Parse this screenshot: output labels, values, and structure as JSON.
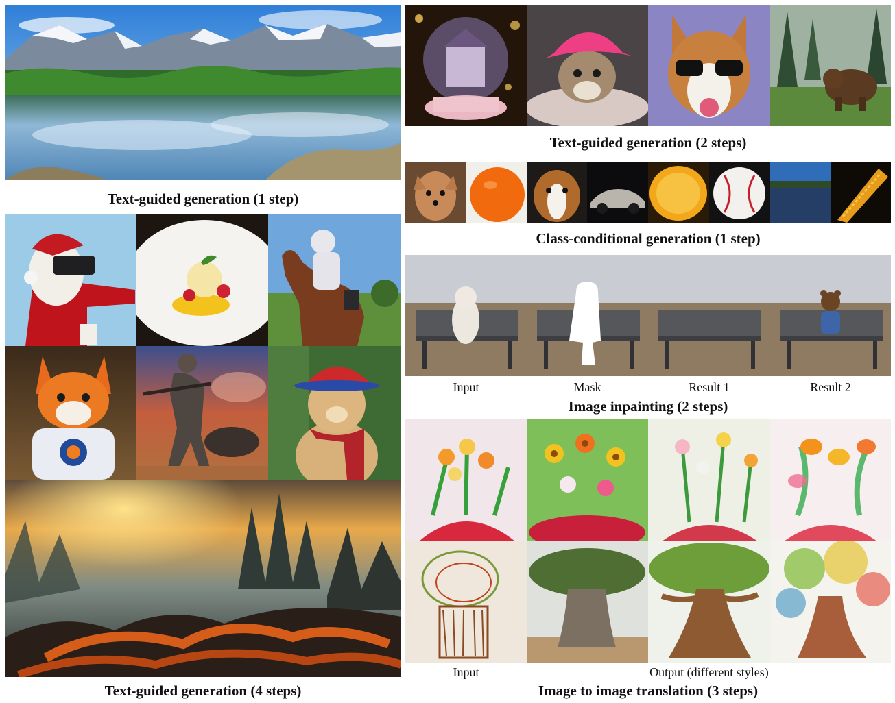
{
  "captions": {
    "text_1step": "Text-guided generation (1 step)",
    "text_4steps": "Text-guided generation (4 steps)",
    "text_2steps": "Text-guided generation (2 steps)",
    "class_cond": "Class-conditional generation (1 step)",
    "inpainting": "Image inpainting (2 steps)",
    "translation": "Image to image translation (3 steps)"
  },
  "inpainting_labels": [
    "Input",
    "Mask",
    "Result 1",
    "Result 2"
  ],
  "translation_labels": {
    "input": "Input",
    "output": "Output (different styles)"
  }
}
